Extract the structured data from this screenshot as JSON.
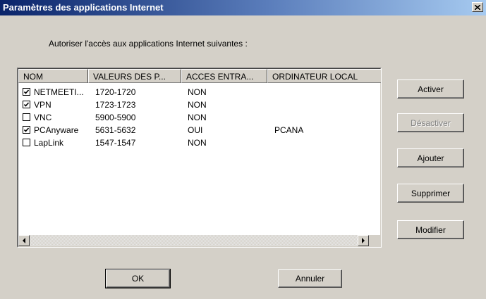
{
  "window": {
    "title": "Paramètres des applications Internet",
    "close_label": "×"
  },
  "prompt": "Autoriser l'accès aux applications Internet suivantes :",
  "list": {
    "columns": [
      "NOM",
      "VALEURS DES P...",
      "ACCES ENTRA...",
      "ORDINATEUR LOCAL"
    ],
    "rows": [
      {
        "checked": true,
        "name": "NETMEETI...",
        "ports": "1720-1720",
        "access": "NON",
        "host": ""
      },
      {
        "checked": true,
        "name": "VPN",
        "ports": "1723-1723",
        "access": "NON",
        "host": ""
      },
      {
        "checked": false,
        "name": "VNC",
        "ports": "5900-5900",
        "access": "NON",
        "host": ""
      },
      {
        "checked": true,
        "name": "PCAnyware",
        "ports": "5631-5632",
        "access": "OUI",
        "host": "PCANA"
      },
      {
        "checked": false,
        "name": "LapLink",
        "ports": "1547-1547",
        "access": "NON",
        "host": ""
      }
    ]
  },
  "buttons": {
    "activate": "Activer",
    "deactivate": "Désactiver",
    "add": "Ajouter",
    "delete": "Supprimer",
    "modify": "Modifier",
    "ok": "OK",
    "cancel": "Annuler"
  },
  "icons": {
    "close": "close-icon",
    "scroll_left": "arrow-left-icon",
    "scroll_right": "arrow-right-icon",
    "check": "checkmark-icon"
  },
  "colors": {
    "face": "#d4d0c8",
    "title_start": "#0a246a",
    "title_end": "#a6caf0"
  }
}
